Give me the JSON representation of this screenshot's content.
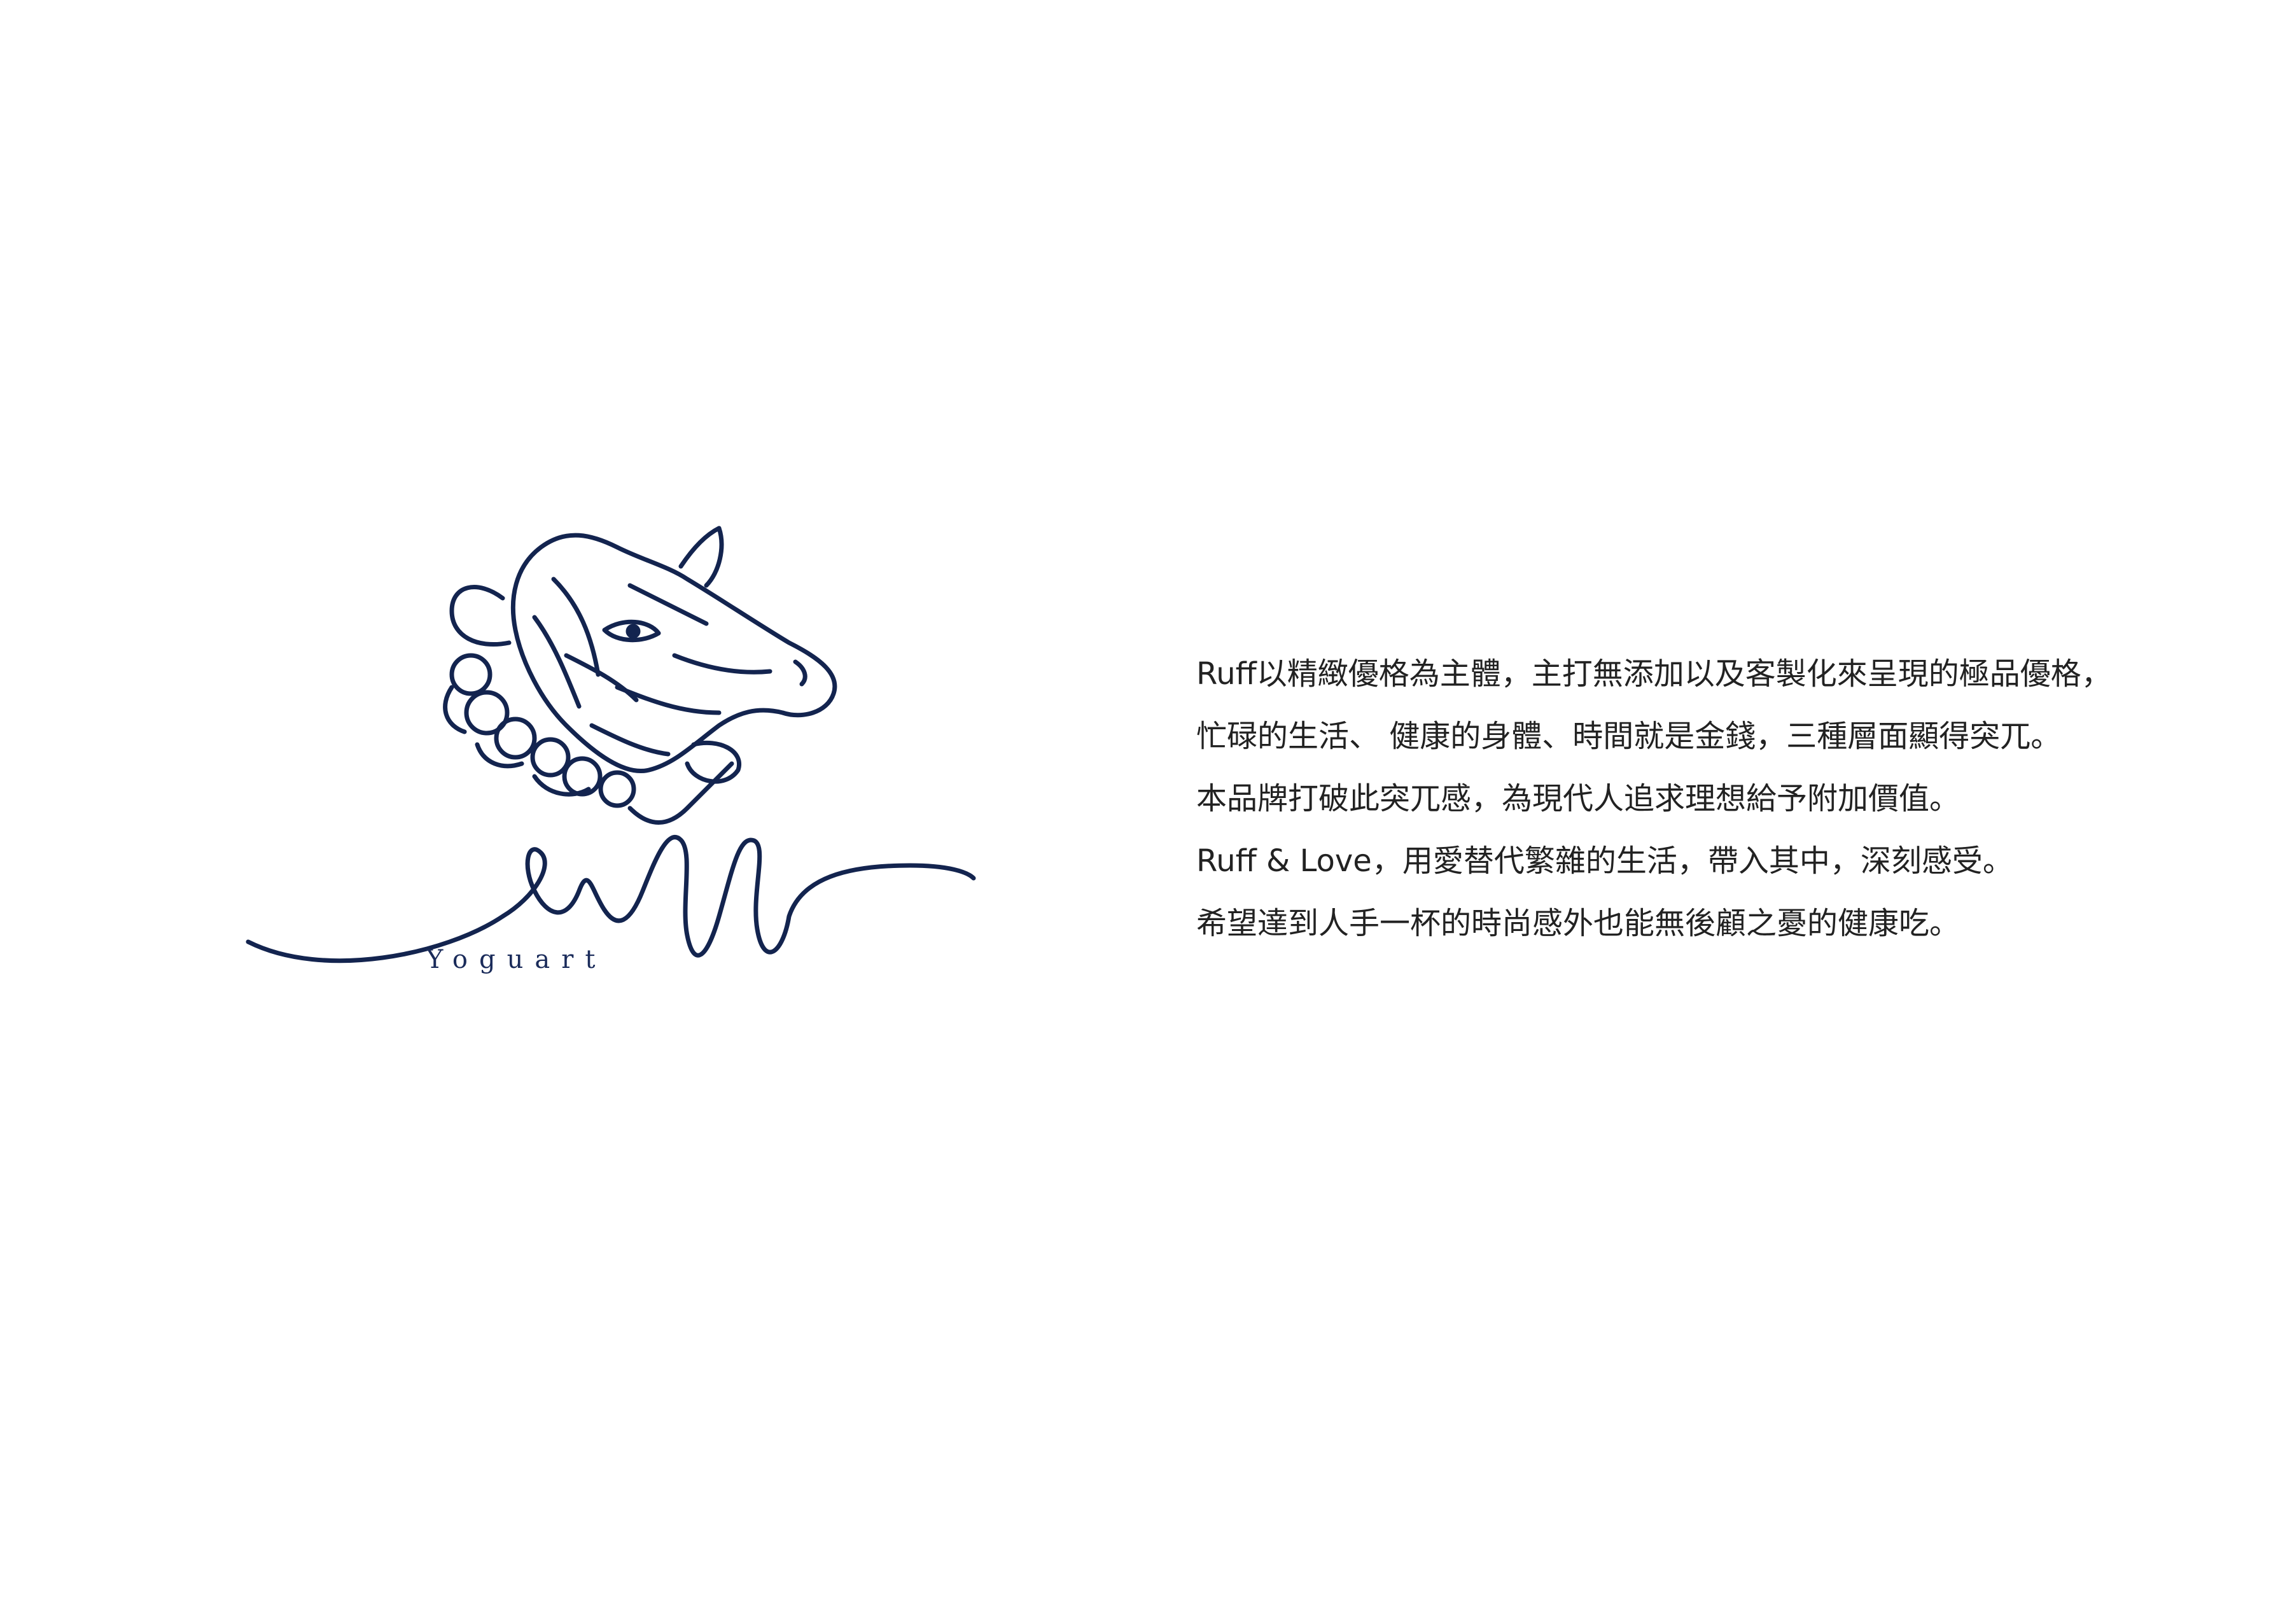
{
  "brand": {
    "tagline": "Yoguart",
    "color": "#13244f"
  },
  "copy": {
    "lines": [
      "Ruff以精緻優格為主體，主打無添加以及客製化來呈現的極品優格，",
      "忙碌的生活、 健康的身體、時間就是金錢，三種層面顯得突兀。",
      "本品牌打破此突兀感，為現代人追求理想給予附加價值。",
      "Ruff & Love，用愛替代繁雜的生活，帶入其中，深刻感受。",
      "希望達到人手一杯的時尚感外也能無後顧之憂的健康吃。"
    ]
  }
}
